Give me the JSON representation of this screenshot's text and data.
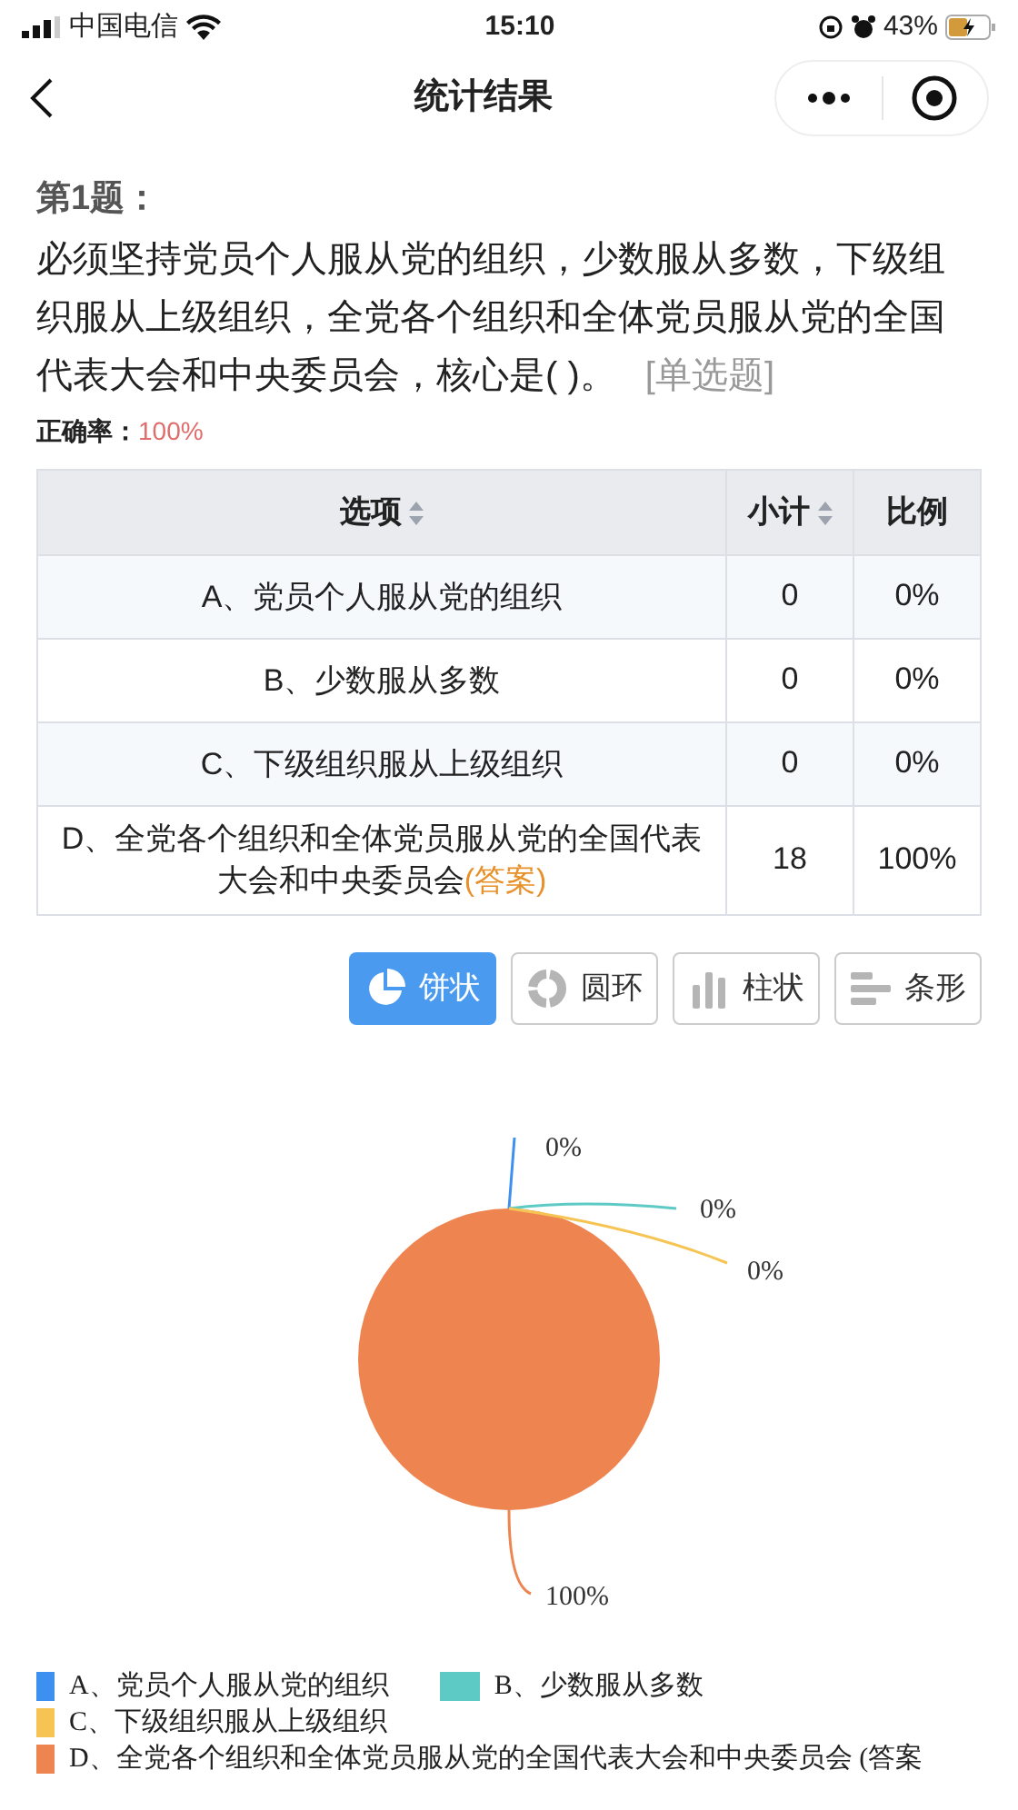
{
  "status_bar": {
    "carrier": "中国电信",
    "time": "15:10",
    "battery": "43%"
  },
  "nav": {
    "title": "统计结果"
  },
  "question": {
    "heading": "第1题：",
    "text": "必须坚持党员个人服从党的组织，少数服从多数，下级组织服从上级组织，全党各个组织和全体党员服从党的全国代表大会和中央委员会，核心是( )。",
    "type_tag": "[单选题]",
    "accuracy_label": "正确率：",
    "accuracy_value": "100%"
  },
  "table": {
    "columns": [
      "选项",
      "小计",
      "比例"
    ],
    "rows": [
      {
        "option": "A、党员个人服从党的组织",
        "count": "0",
        "ratio": "0%"
      },
      {
        "option": "B、少数服从多数",
        "count": "0",
        "ratio": "0%"
      },
      {
        "option": "C、下级组织服从上级组织",
        "count": "0",
        "ratio": "0%"
      },
      {
        "option": "D、全党各个组织和全体党员服从党的全国代表大会和中央委员会",
        "answer_tag": "(答案)",
        "count": "18",
        "ratio": "100%"
      }
    ]
  },
  "chart_types": [
    {
      "kind": "pie",
      "label": "饼状",
      "selected": true
    },
    {
      "kind": "donut",
      "label": "圆环",
      "selected": false
    },
    {
      "kind": "column",
      "label": "柱状",
      "selected": false
    },
    {
      "kind": "bar",
      "label": "条形",
      "selected": false
    }
  ],
  "chart_data": {
    "type": "pie",
    "categories": [
      "A、党员个人服从党的组织",
      "B、少数服从多数",
      "C、下级组织服从上级组织",
      "D、全党各个组织和全体党员服从党的全国代表大会和中央委员会 (答案"
    ],
    "series": [
      {
        "values": [
          0,
          0,
          0,
          100
        ]
      }
    ],
    "value_labels": [
      "0%",
      "0%",
      "0%",
      "100%"
    ]
  },
  "legend": [
    {
      "color": "#3d8ff0"
    },
    {
      "color": "#5ecac6"
    },
    {
      "color": "#f6c453"
    },
    {
      "color": "#ee8450"
    }
  ]
}
